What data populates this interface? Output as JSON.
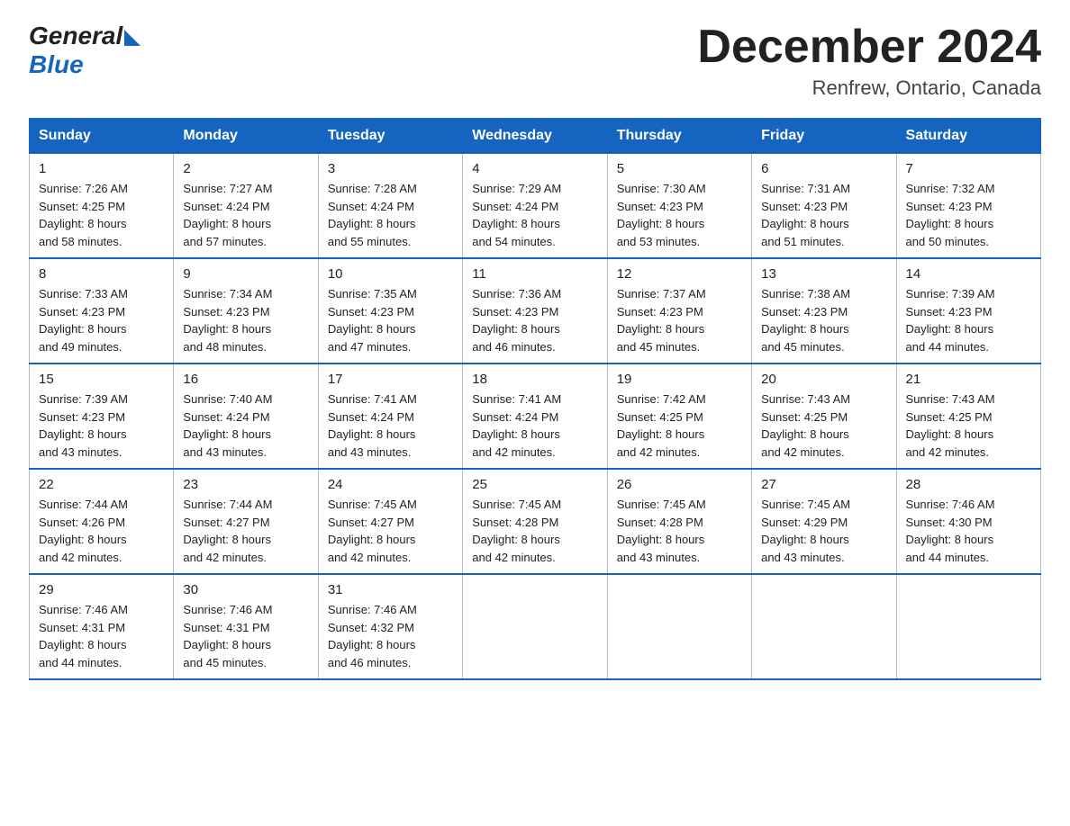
{
  "logo": {
    "general": "General",
    "blue": "Blue"
  },
  "title": "December 2024",
  "location": "Renfrew, Ontario, Canada",
  "days_of_week": [
    "Sunday",
    "Monday",
    "Tuesday",
    "Wednesday",
    "Thursday",
    "Friday",
    "Saturday"
  ],
  "weeks": [
    [
      {
        "day": "1",
        "sunrise": "7:26 AM",
        "sunset": "4:25 PM",
        "daylight": "8 hours and 58 minutes."
      },
      {
        "day": "2",
        "sunrise": "7:27 AM",
        "sunset": "4:24 PM",
        "daylight": "8 hours and 57 minutes."
      },
      {
        "day": "3",
        "sunrise": "7:28 AM",
        "sunset": "4:24 PM",
        "daylight": "8 hours and 55 minutes."
      },
      {
        "day": "4",
        "sunrise": "7:29 AM",
        "sunset": "4:24 PM",
        "daylight": "8 hours and 54 minutes."
      },
      {
        "day": "5",
        "sunrise": "7:30 AM",
        "sunset": "4:23 PM",
        "daylight": "8 hours and 53 minutes."
      },
      {
        "day": "6",
        "sunrise": "7:31 AM",
        "sunset": "4:23 PM",
        "daylight": "8 hours and 51 minutes."
      },
      {
        "day": "7",
        "sunrise": "7:32 AM",
        "sunset": "4:23 PM",
        "daylight": "8 hours and 50 minutes."
      }
    ],
    [
      {
        "day": "8",
        "sunrise": "7:33 AM",
        "sunset": "4:23 PM",
        "daylight": "8 hours and 49 minutes."
      },
      {
        "day": "9",
        "sunrise": "7:34 AM",
        "sunset": "4:23 PM",
        "daylight": "8 hours and 48 minutes."
      },
      {
        "day": "10",
        "sunrise": "7:35 AM",
        "sunset": "4:23 PM",
        "daylight": "8 hours and 47 minutes."
      },
      {
        "day": "11",
        "sunrise": "7:36 AM",
        "sunset": "4:23 PM",
        "daylight": "8 hours and 46 minutes."
      },
      {
        "day": "12",
        "sunrise": "7:37 AM",
        "sunset": "4:23 PM",
        "daylight": "8 hours and 45 minutes."
      },
      {
        "day": "13",
        "sunrise": "7:38 AM",
        "sunset": "4:23 PM",
        "daylight": "8 hours and 45 minutes."
      },
      {
        "day": "14",
        "sunrise": "7:39 AM",
        "sunset": "4:23 PM",
        "daylight": "8 hours and 44 minutes."
      }
    ],
    [
      {
        "day": "15",
        "sunrise": "7:39 AM",
        "sunset": "4:23 PM",
        "daylight": "8 hours and 43 minutes."
      },
      {
        "day": "16",
        "sunrise": "7:40 AM",
        "sunset": "4:24 PM",
        "daylight": "8 hours and 43 minutes."
      },
      {
        "day": "17",
        "sunrise": "7:41 AM",
        "sunset": "4:24 PM",
        "daylight": "8 hours and 43 minutes."
      },
      {
        "day": "18",
        "sunrise": "7:41 AM",
        "sunset": "4:24 PM",
        "daylight": "8 hours and 42 minutes."
      },
      {
        "day": "19",
        "sunrise": "7:42 AM",
        "sunset": "4:25 PM",
        "daylight": "8 hours and 42 minutes."
      },
      {
        "day": "20",
        "sunrise": "7:43 AM",
        "sunset": "4:25 PM",
        "daylight": "8 hours and 42 minutes."
      },
      {
        "day": "21",
        "sunrise": "7:43 AM",
        "sunset": "4:25 PM",
        "daylight": "8 hours and 42 minutes."
      }
    ],
    [
      {
        "day": "22",
        "sunrise": "7:44 AM",
        "sunset": "4:26 PM",
        "daylight": "8 hours and 42 minutes."
      },
      {
        "day": "23",
        "sunrise": "7:44 AM",
        "sunset": "4:27 PM",
        "daylight": "8 hours and 42 minutes."
      },
      {
        "day": "24",
        "sunrise": "7:45 AM",
        "sunset": "4:27 PM",
        "daylight": "8 hours and 42 minutes."
      },
      {
        "day": "25",
        "sunrise": "7:45 AM",
        "sunset": "4:28 PM",
        "daylight": "8 hours and 42 minutes."
      },
      {
        "day": "26",
        "sunrise": "7:45 AM",
        "sunset": "4:28 PM",
        "daylight": "8 hours and 43 minutes."
      },
      {
        "day": "27",
        "sunrise": "7:45 AM",
        "sunset": "4:29 PM",
        "daylight": "8 hours and 43 minutes."
      },
      {
        "day": "28",
        "sunrise": "7:46 AM",
        "sunset": "4:30 PM",
        "daylight": "8 hours and 44 minutes."
      }
    ],
    [
      {
        "day": "29",
        "sunrise": "7:46 AM",
        "sunset": "4:31 PM",
        "daylight": "8 hours and 44 minutes."
      },
      {
        "day": "30",
        "sunrise": "7:46 AM",
        "sunset": "4:31 PM",
        "daylight": "8 hours and 45 minutes."
      },
      {
        "day": "31",
        "sunrise": "7:46 AM",
        "sunset": "4:32 PM",
        "daylight": "8 hours and 46 minutes."
      },
      null,
      null,
      null,
      null
    ]
  ],
  "labels": {
    "sunrise": "Sunrise:",
    "sunset": "Sunset:",
    "daylight": "Daylight:"
  }
}
